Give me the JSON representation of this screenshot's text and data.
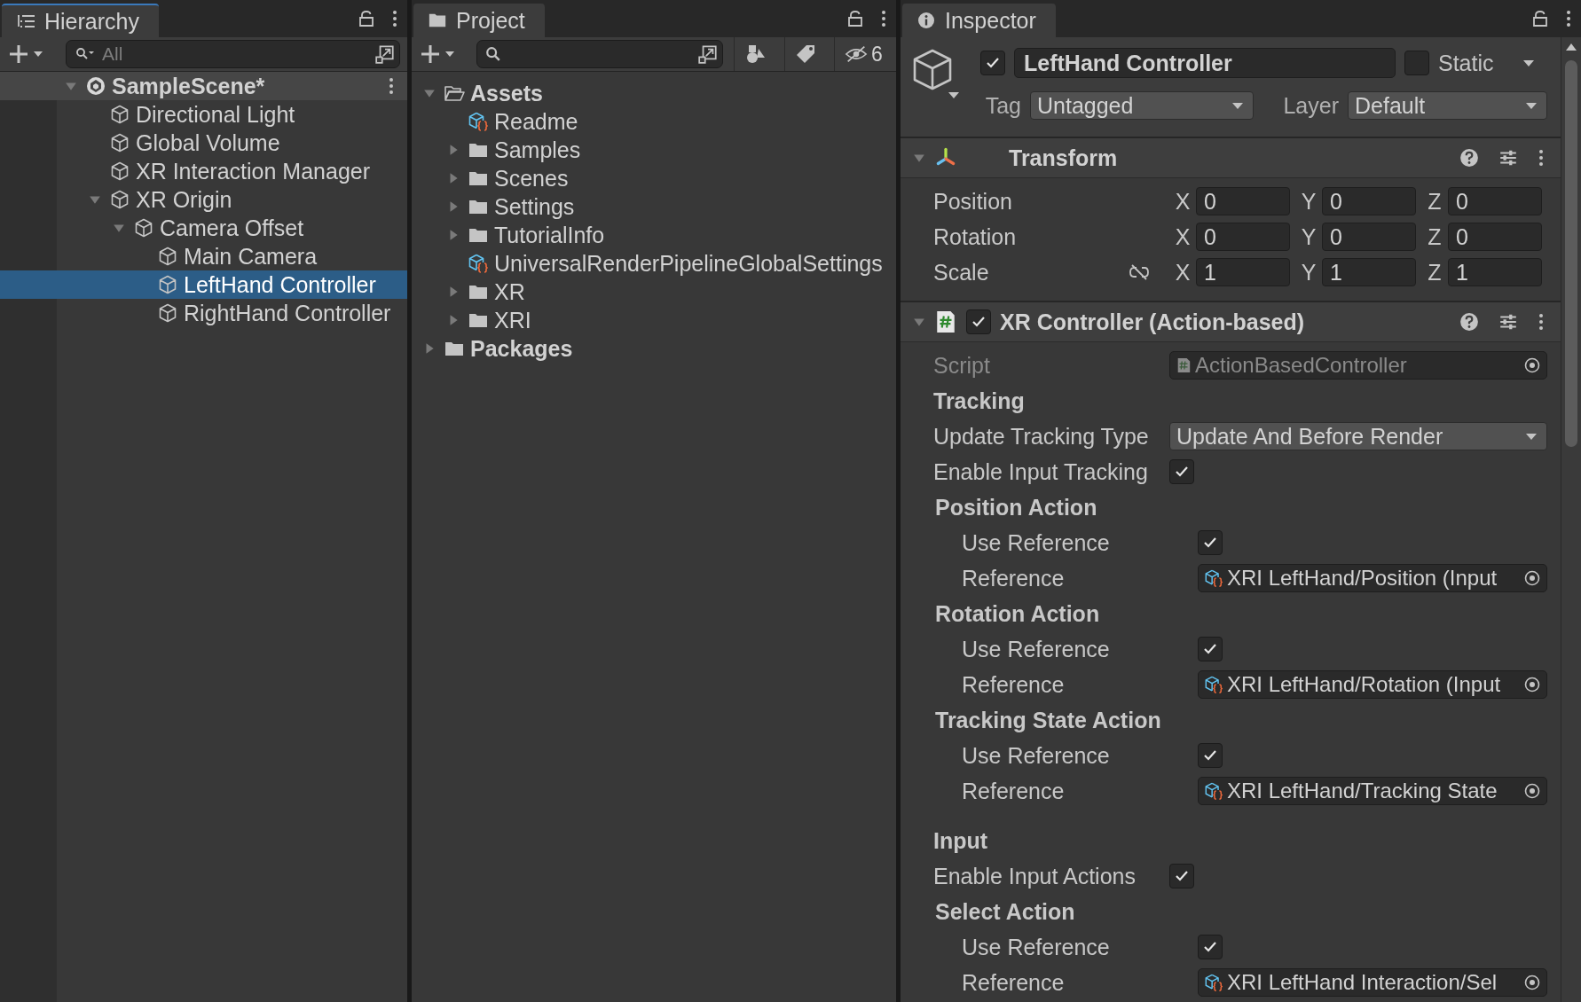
{
  "hierarchy": {
    "title": "Hierarchy",
    "search_placeholder": "All",
    "scene": {
      "name": "SampleScene*",
      "expanded": true,
      "children": [
        {
          "name": "Directional Light",
          "selected": false
        },
        {
          "name": "Global Volume",
          "selected": false
        },
        {
          "name": "XR Interaction Manager",
          "selected": false
        },
        {
          "name": "XR Origin",
          "selected": false,
          "expanded": true,
          "children": [
            {
              "name": "Camera Offset",
              "selected": false,
              "expanded": true,
              "children": [
                {
                  "name": "Main Camera",
                  "selected": false
                },
                {
                  "name": "LeftHand Controller",
                  "selected": true
                },
                {
                  "name": "RightHand Controller",
                  "selected": false
                }
              ]
            }
          ]
        }
      ]
    }
  },
  "project": {
    "title": "Project",
    "hidden_count": "6",
    "tree": [
      {
        "name": "Assets",
        "kind": "folder",
        "selected": false,
        "expanded": true,
        "children": [
          {
            "name": "Readme",
            "kind": "asset",
            "selected": false
          },
          {
            "name": "Samples",
            "kind": "folder",
            "selected": false,
            "expanded": false
          },
          {
            "name": "Scenes",
            "kind": "folder",
            "selected": false,
            "expanded": false
          },
          {
            "name": "Settings",
            "kind": "folder",
            "selected": false,
            "expanded": false
          },
          {
            "name": "TutorialInfo",
            "kind": "folder",
            "selected": false,
            "expanded": false
          },
          {
            "name": "UniversalRenderPipelineGlobalSettings",
            "kind": "asset",
            "selected": false
          },
          {
            "name": "XR",
            "kind": "folder",
            "selected": false,
            "expanded": false
          },
          {
            "name": "XRI",
            "kind": "folder",
            "selected": false,
            "expanded": false
          }
        ]
      },
      {
        "name": "Packages",
        "kind": "folder",
        "selected": false,
        "expanded": false
      }
    ]
  },
  "inspector": {
    "title": "Inspector",
    "object": {
      "active": true,
      "name": "LeftHand Controller",
      "static": false,
      "static_label": "Static",
      "tag_label": "Tag",
      "tag": "Untagged",
      "layer_label": "Layer",
      "layer": "Default"
    },
    "components": [
      {
        "kind": "transform",
        "title": "Transform",
        "expanded": true,
        "rows": [
          {
            "label": "Position",
            "values": [
              {
                "axis": "X",
                "value": "0"
              },
              {
                "axis": "Y",
                "value": "0"
              },
              {
                "axis": "Z",
                "value": "0"
              }
            ]
          },
          {
            "label": "Rotation",
            "values": [
              {
                "axis": "X",
                "value": "0"
              },
              {
                "axis": "Y",
                "value": "0"
              },
              {
                "axis": "Z",
                "value": "0"
              }
            ]
          },
          {
            "label": "Scale",
            "constrained": false,
            "values": [
              {
                "axis": "X",
                "value": "1"
              },
              {
                "axis": "Y",
                "value": "1"
              },
              {
                "axis": "Z",
                "value": "1"
              }
            ]
          }
        ]
      },
      {
        "kind": "script",
        "title": "XR Controller (Action-based)",
        "enabled": true,
        "expanded": true,
        "properties": [
          {
            "kind": "script",
            "label": "Script",
            "value": "ActionBasedController",
            "disabled": true
          },
          {
            "kind": "section",
            "label": "Tracking"
          },
          {
            "kind": "dropdown",
            "label": "Update Tracking Type",
            "value": "Update And Before Render"
          },
          {
            "kind": "toggle",
            "label": "Enable Input Tracking",
            "checked": true
          },
          {
            "kind": "group",
            "label": "Position Action",
            "children": [
              {
                "kind": "toggle",
                "label": "Use Reference",
                "checked": true
              },
              {
                "kind": "reference",
                "label": "Reference",
                "value": "XRI LeftHand/Position (Input"
              }
            ]
          },
          {
            "kind": "group",
            "label": "Rotation Action",
            "children": [
              {
                "kind": "toggle",
                "label": "Use Reference",
                "checked": true
              },
              {
                "kind": "reference",
                "label": "Reference",
                "value": "XRI LeftHand/Rotation (Input"
              }
            ]
          },
          {
            "kind": "group",
            "label": "Tracking State Action",
            "children": [
              {
                "kind": "toggle",
                "label": "Use Reference",
                "checked": true
              },
              {
                "kind": "reference",
                "label": "Reference",
                "value": "XRI LeftHand/Tracking State"
              }
            ]
          },
          {
            "kind": "section",
            "label": "Input"
          },
          {
            "kind": "toggle",
            "label": "Enable Input Actions",
            "checked": true
          },
          {
            "kind": "group",
            "label": "Select Action",
            "children": [
              {
                "kind": "toggle",
                "label": "Use Reference",
                "checked": true
              },
              {
                "kind": "reference",
                "label": "Reference",
                "value": "XRI LeftHand Interaction/Sel"
              }
            ]
          }
        ]
      }
    ]
  }
}
